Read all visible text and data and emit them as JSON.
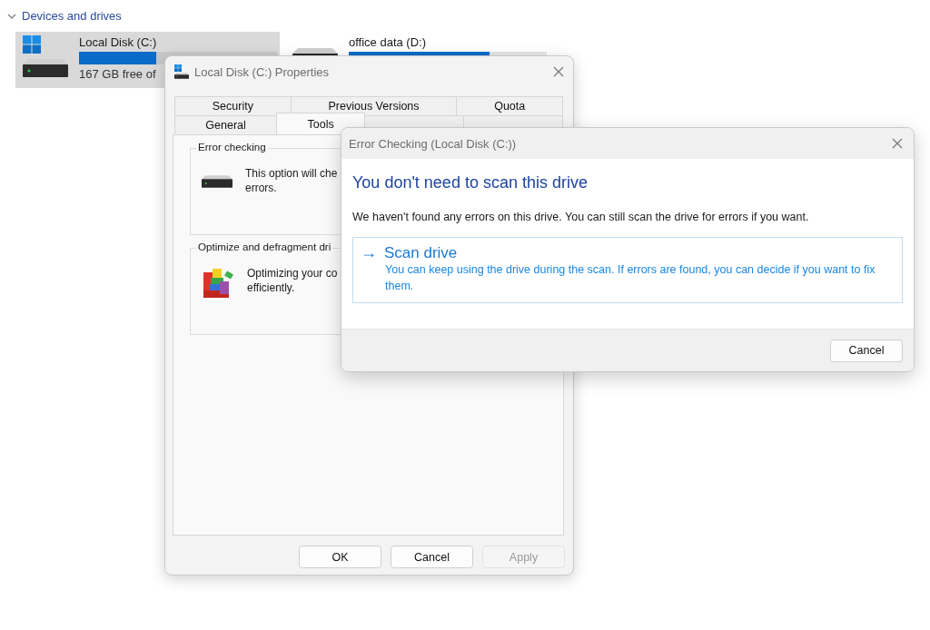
{
  "section": {
    "label": "Devices and drives",
    "expanded": true
  },
  "drives": [
    {
      "name": "Local Disk (C:)",
      "level": 0.39,
      "free": "167 GB free of",
      "selected": true,
      "system": true
    },
    {
      "name": "office data (D:)",
      "level": 0.71,
      "selected": false,
      "system": false
    }
  ],
  "properties": {
    "title": "Local Disk (C:) Properties",
    "tab_rows": [
      [
        {
          "label": "Security",
          "selected": false
        },
        {
          "label": "Previous Versions",
          "selected": false
        },
        {
          "label": "Quota",
          "selected": false
        }
      ],
      [
        {
          "label": "General",
          "selected": false
        },
        {
          "label": "Tools",
          "selected": true
        },
        {
          "selected": false
        },
        {
          "selected": false
        }
      ]
    ],
    "groups": [
      {
        "title": "Error checking",
        "kind": "drive",
        "lines": [
          "This option will che",
          "errors."
        ]
      },
      {
        "title": "Optimize and defragment dri",
        "kind": "defrag",
        "lines": [
          "Optimizing your co",
          "efficiently."
        ]
      }
    ],
    "buttons": [
      {
        "label": "OK",
        "disabled": false
      },
      {
        "label": "Cancel",
        "disabled": false
      },
      {
        "label": "Apply",
        "disabled": true
      }
    ]
  },
  "error_dialog": {
    "title": "Error Checking (Local Disk (C:))",
    "heading": "You don't need to scan this drive",
    "message": "We haven't found any errors on this drive. You can still scan the drive for errors if you want.",
    "action": {
      "arrow": "→",
      "title": "Scan drive",
      "description": "You can keep using the drive during the scan. If errors are found, you can decide if you want to fix them."
    },
    "buttons": [
      {
        "label": "Cancel",
        "disabled": false
      }
    ]
  }
}
